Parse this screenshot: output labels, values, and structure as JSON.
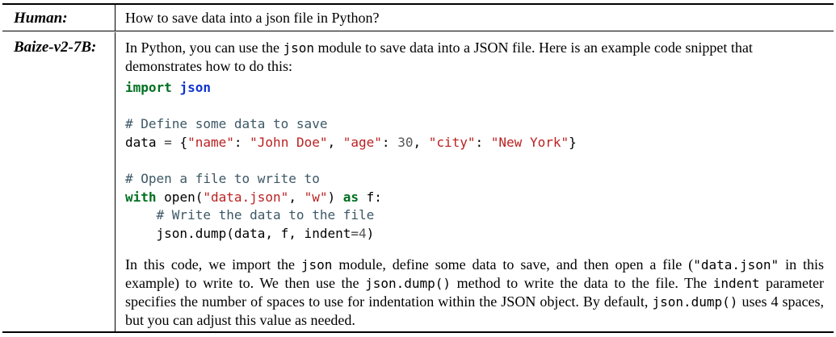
{
  "conversation": {
    "human_label": "Human:",
    "human_text": "How to save data into a json file in Python?",
    "bot_label": "Baize-v2-7B:",
    "intro": {
      "part1": "In Python, you can use the ",
      "code1": "json",
      "part2": " module to save data into a JSON file. Here is an example code snippet that demonstrates how to do this:"
    },
    "code": {
      "l1_kw": "import",
      "l1_mod": "json",
      "l3_comment": "# Define some data to save",
      "l4_var": "data",
      "l4_eq": "=",
      "l4_brace_open": "{",
      "l4_k1": "\"name\"",
      "l4_v1": "\"John Doe\"",
      "l4_k2": "\"age\"",
      "l4_v2": "30",
      "l4_k3": "\"city\"",
      "l4_v3": "\"New York\"",
      "l4_brace_close": "}",
      "l6_comment": "# Open a file to write to",
      "l7_kw": "with",
      "l7_func": "open",
      "l7_a1": "\"data.json\"",
      "l7_a2": "\"w\"",
      "l7_as": "as",
      "l7_var": "f",
      "l8_comment": "# Write the data to the file",
      "l9_call": "json.dump(data, f, indent",
      "l9_eq": "=",
      "l9_num": "4",
      "l9_close": ")"
    },
    "outro": {
      "t1": "In this code, we import the ",
      "c1": "json",
      "t2": " module, define some data to save, and then open a file (",
      "c2": "\"data.json\"",
      "t3": " in this example) to write to.  We then use the ",
      "c3": "json.dump()",
      "t4": " method to write the data to the file.  The ",
      "c4": "indent",
      "t5": " parameter specifies the number of spaces to use for indentation within the JSON object. By default, ",
      "c5": "json.dump()",
      "t6": " uses 4 spaces, but you can adjust this value as needed."
    }
  }
}
